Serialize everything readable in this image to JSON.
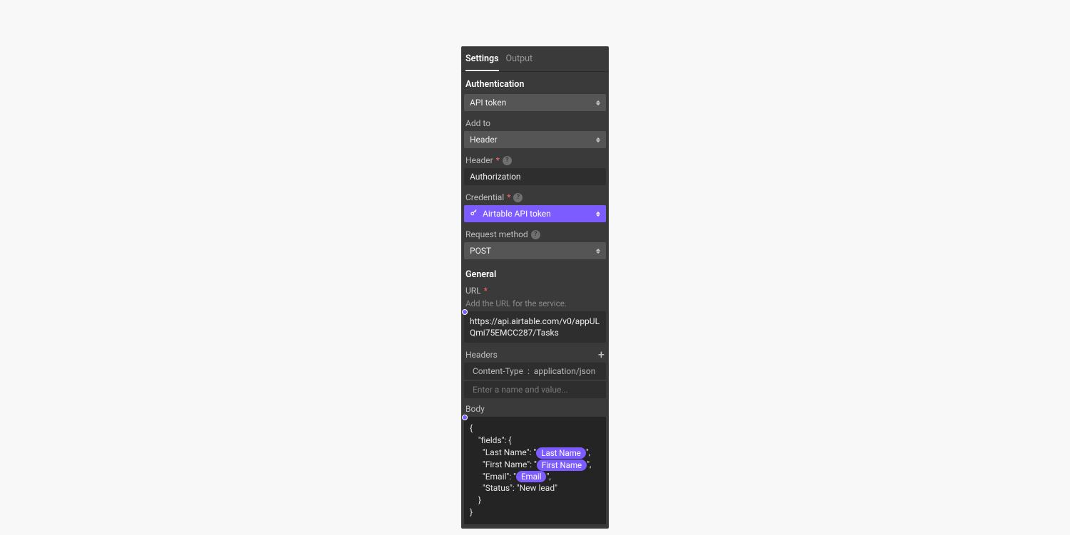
{
  "tabs": {
    "settings": "Settings",
    "output": "Output"
  },
  "sections": {
    "auth": "Authentication",
    "general": "General"
  },
  "labels": {
    "add_to": "Add to",
    "header": "Header",
    "credential": "Credential",
    "request_method": "Request method",
    "url": "URL",
    "url_helper": "Add the URL for the service.",
    "headers": "Headers",
    "body": "Body"
  },
  "values": {
    "auth_select": "API token",
    "add_to_select": "Header",
    "header_input": "Authorization",
    "credential_select": "Airtable API token",
    "method_select": "POST",
    "url_input": "https://api.airtable.com/v0/appULQmi75EMCC287/Tasks"
  },
  "headers_rows": {
    "row0_key": "Content-Type",
    "row0_sep": ":",
    "row0_val": "application/json",
    "placeholder": "Enter a name and value..."
  },
  "body": {
    "l1": "{",
    "l2": "    \"fields\": {",
    "l3a": "      \"Last Name\": \"",
    "l3pill": "Last Name",
    "l3b": "\",",
    "l4a": "      \"First Name\": \"",
    "l4pill": "First Name",
    "l4b": "\",",
    "l5a": "      \"Email\": \"",
    "l5pill": "Email",
    "l5b": "\",",
    "l6": "      \"Status\": \"New lead\"",
    "l7": "    }",
    "l8": "}"
  }
}
